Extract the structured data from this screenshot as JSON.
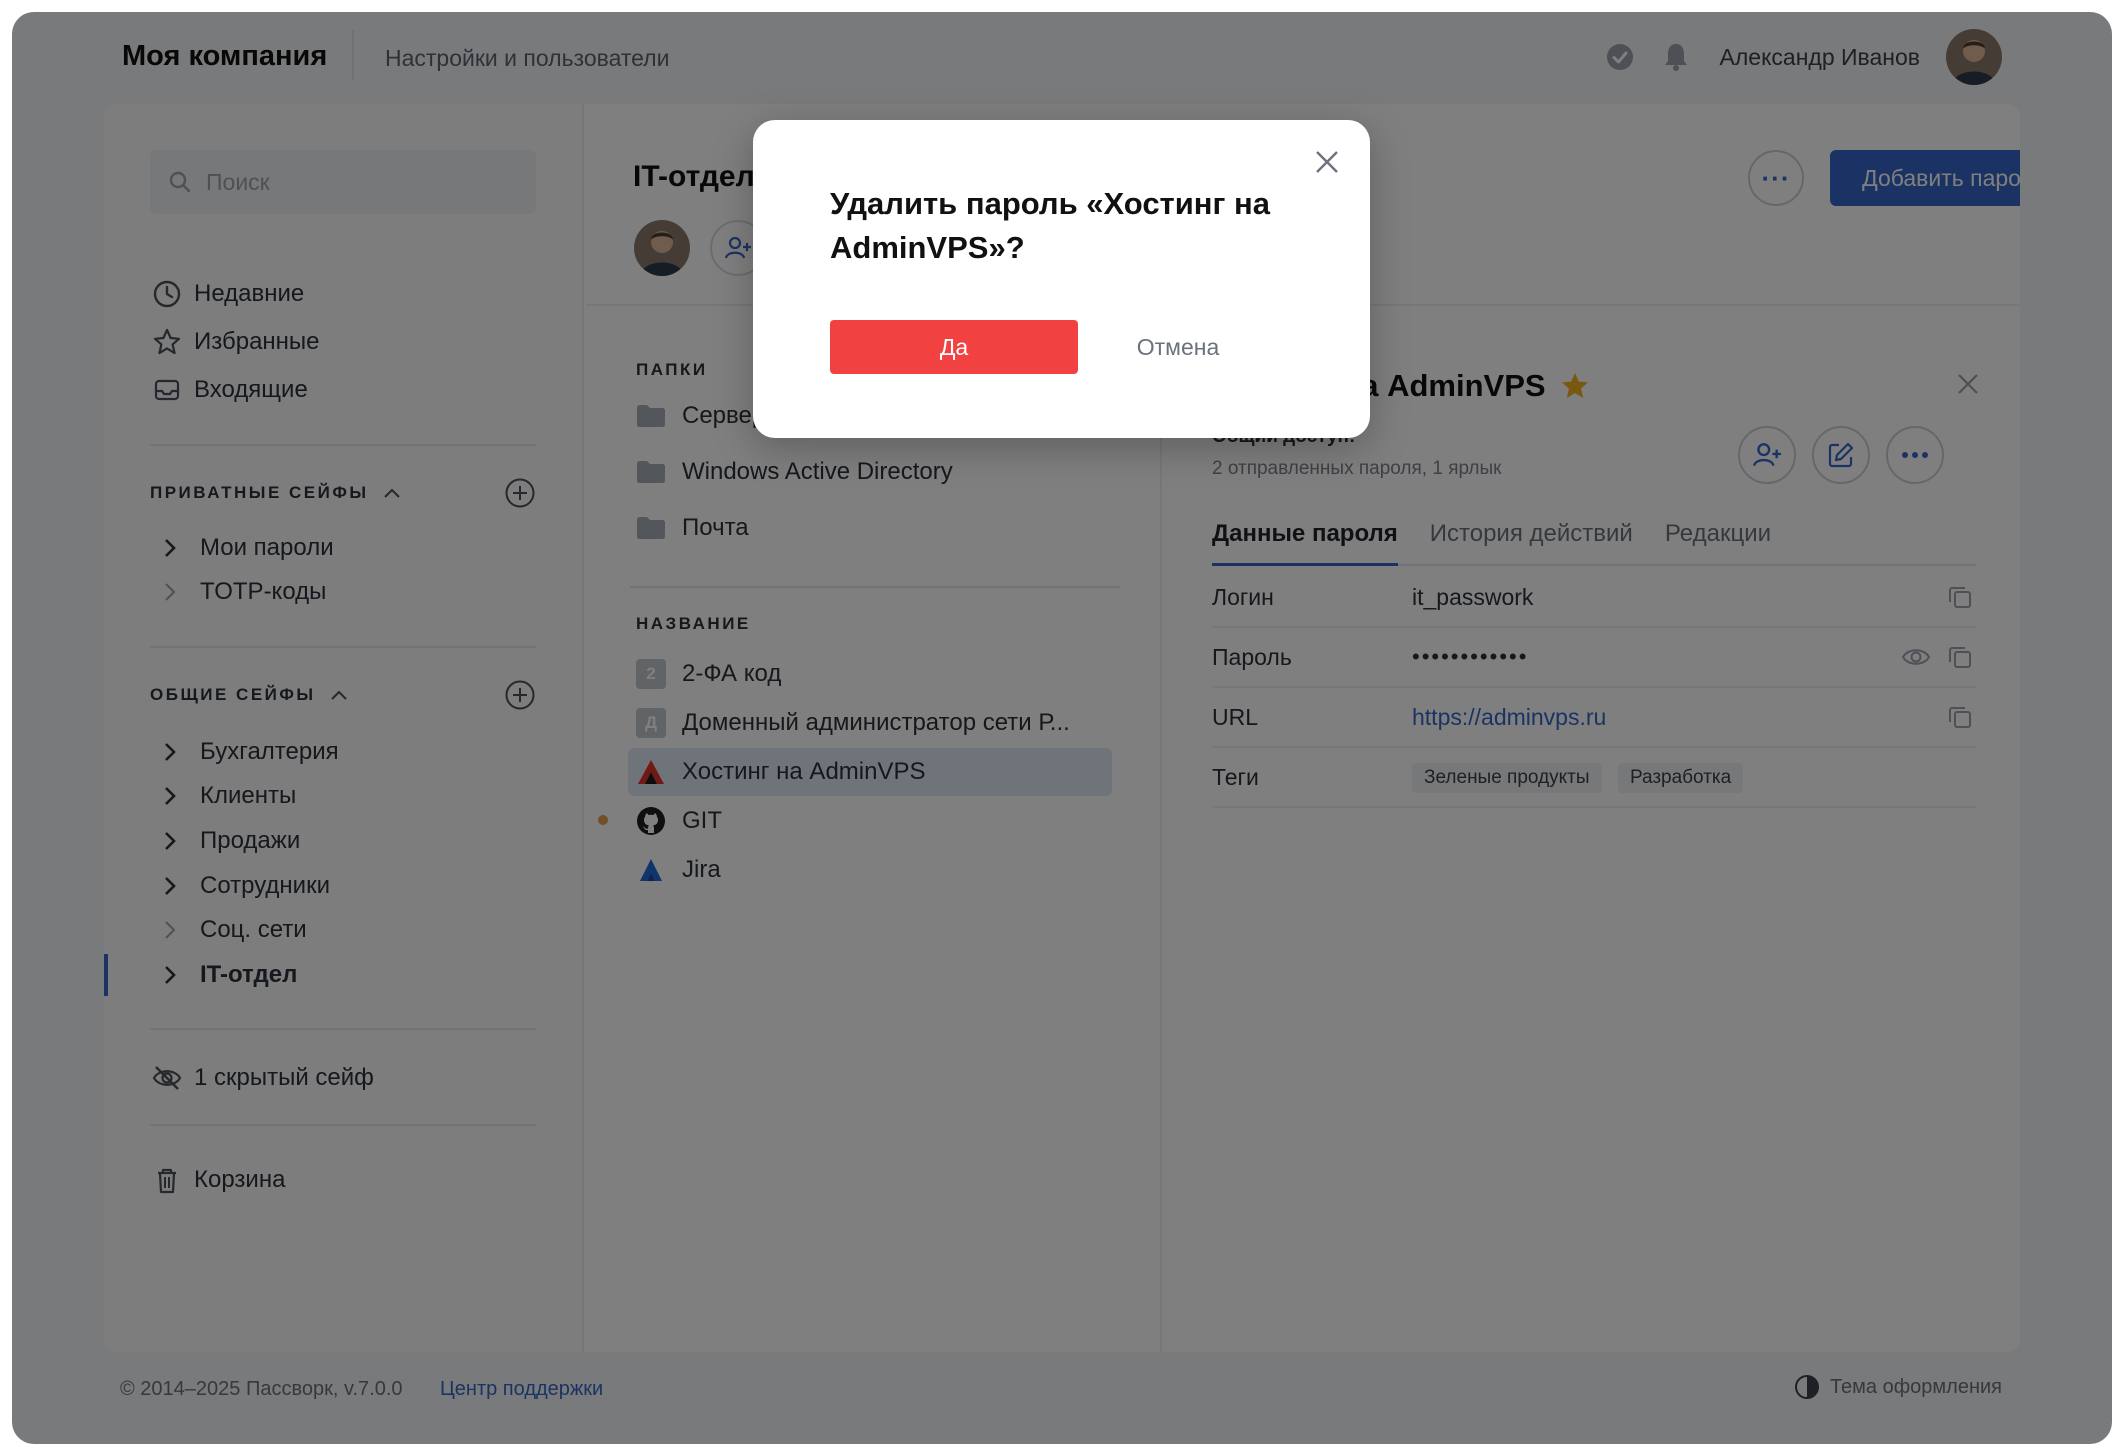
{
  "header": {
    "company": "Моя компания",
    "nav_link": "Настройки и пользователи",
    "username": "Александр Иванов"
  },
  "sidebar": {
    "search_placeholder": "Поиск",
    "quick": [
      {
        "label": "Недавние",
        "icon": "clock-icon"
      },
      {
        "label": "Избранные",
        "icon": "star-icon"
      },
      {
        "label": "Входящие",
        "icon": "inbox-icon"
      }
    ],
    "private_title": "ПРИВАТНЫЕ СЕЙФЫ",
    "private_vaults": [
      "Мои пароли",
      "TOTP-коды"
    ],
    "shared_title": "ОБЩИЕ СЕЙФЫ",
    "shared_vaults": [
      "Бухгалтерия",
      "Клиенты",
      "Продажи",
      "Сотрудники",
      "Соц. сети",
      "IT-отдел"
    ],
    "hidden": "1 скрытый сейф",
    "trash": "Корзина"
  },
  "vault": {
    "title": "IT-отдел",
    "more_label": "···",
    "add_password": "Добавить пароль"
  },
  "folders": {
    "heading": "ПАПКИ",
    "items": [
      "Серверы",
      "Windows Active Directory",
      "Почта"
    ]
  },
  "items": {
    "heading": "НАЗВАНИЕ",
    "list": [
      {
        "label": "2-ФА код",
        "letter": "2"
      },
      {
        "label": "Доменный администратор сети Р...",
        "letter": "Д"
      },
      {
        "label": "Хостинг на AdminVPS",
        "icon": "adminvps-logo-icon"
      },
      {
        "label": "GIT",
        "icon": "github-icon"
      },
      {
        "label": "Jira",
        "icon": "jira-icon"
      }
    ]
  },
  "detail": {
    "title": "Хостинг на AdminVPS",
    "access": "Общий доступ:",
    "access_sub": "2 отправленных пароля, 1 ярлык",
    "tabs": [
      "Данные пароля",
      "История действий",
      "Редакции"
    ],
    "fields": [
      {
        "key": "Логин",
        "value": "it_passwork"
      },
      {
        "key": "Пароль",
        "value": "••••••••••••"
      },
      {
        "key": "URL",
        "value": "https://adminvps.ru"
      }
    ],
    "tags_label": "Теги",
    "tags": [
      "Зеленые продукты",
      "Разработка"
    ]
  },
  "footer": {
    "copyright": "© 2014–2025 Пассворк, v.7.0.0",
    "support": "Центр поддержки",
    "theme": "Тема оформления"
  },
  "modal": {
    "title": "Удалить пароль «Хостинг на AdminVPS»?",
    "yes": "Да",
    "cancel": "Отмена"
  },
  "colors": {
    "accent": "#3767c9",
    "danger": "#f24141",
    "star": "#f2b01e"
  }
}
